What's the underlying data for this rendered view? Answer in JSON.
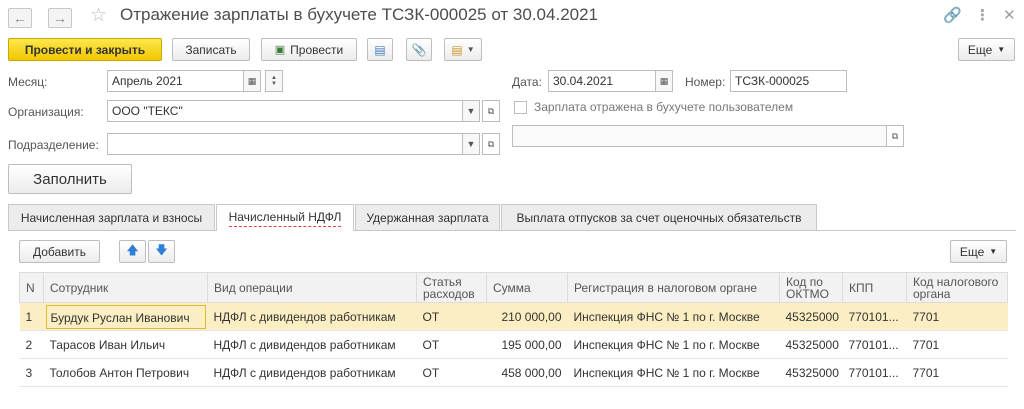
{
  "window": {
    "title": "Отражение зарплаты в бухучете ТСЗК-000025 от 30.04.2021"
  },
  "toolbar": {
    "post_close": "Провести и закрыть",
    "save": "Записать",
    "post": "Провести",
    "more": "Еще"
  },
  "form": {
    "month_label": "Месяц:",
    "month_value": "Апрель 2021",
    "org_label": "Организация:",
    "org_value": "ООО \"ТЕКС\"",
    "dept_label": "Подразделение:",
    "dept_value": "",
    "date_label": "Дата:",
    "date_value": "30.04.2021",
    "number_label": "Номер:",
    "number_value": "ТСЗК-000025",
    "checkbox_label": "Зарплата отражена в бухучете пользователем",
    "fill_button": "Заполнить"
  },
  "tabs": [
    {
      "label": "Начисленная зарплата и взносы"
    },
    {
      "label": "Начисленный НДФЛ"
    },
    {
      "label": "Удержанная зарплата"
    },
    {
      "label": "Выплата отпусков за счет оценочных обязательств"
    }
  ],
  "table_toolbar": {
    "add": "Добавить",
    "more": "Еще"
  },
  "table": {
    "headers": [
      "N",
      "Сотрудник",
      "Вид операции",
      "Статья расходов",
      "Сумма",
      "Регистрация в налоговом органе",
      "Код по ОКТМО",
      "КПП",
      "Код налогового органа"
    ],
    "rows": [
      [
        "1",
        "Бурдук Руслан Иванович",
        "НДФЛ с дивидендов работникам",
        "ОТ",
        "210 000,00",
        "Инспекция ФНС № 1 по г. Москве",
        "45325000",
        "770101...",
        "7701"
      ],
      [
        "2",
        "Тарасов Иван Ильич",
        "НДФЛ с дивидендов работникам",
        "ОТ",
        "195 000,00",
        "Инспекция ФНС № 1 по г. Москве",
        "45325000",
        "770101...",
        "7701"
      ],
      [
        "3",
        "Толобов Антон Петрович",
        "НДФЛ с дивидендов работникам",
        "ОТ",
        "458 000,00",
        "Инспекция ФНС № 1 по г. Москве",
        "45325000",
        "770101...",
        "7701"
      ]
    ]
  }
}
